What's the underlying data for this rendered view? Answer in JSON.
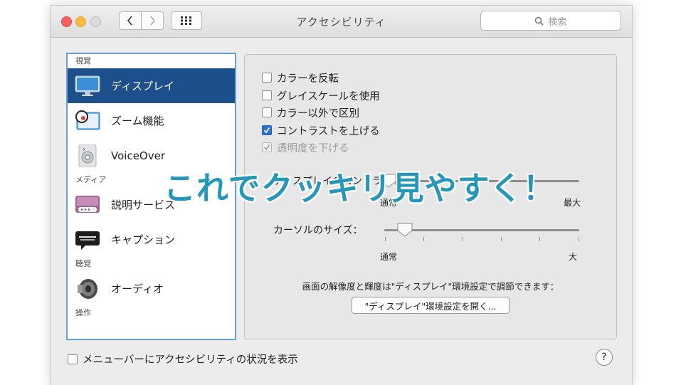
{
  "window": {
    "title": "アクセシビリティ"
  },
  "search": {
    "placeholder": "検索"
  },
  "sidebar": {
    "sections": [
      {
        "header": "視覚",
        "items": [
          {
            "label": "ディスプレイ",
            "icon": "display-icon",
            "selected": true
          },
          {
            "label": "ズーム機能",
            "icon": "zoom-icon",
            "selected": false
          },
          {
            "label": "VoiceOver",
            "icon": "voiceover-icon",
            "selected": false
          }
        ]
      },
      {
        "header": "メディア",
        "items": [
          {
            "label": "説明サービス",
            "icon": "descriptions-icon",
            "selected": false
          },
          {
            "label": "キャプション",
            "icon": "captions-icon",
            "selected": false
          }
        ]
      },
      {
        "header": "聴覚",
        "items": [
          {
            "label": "オーディオ",
            "icon": "speaker-icon",
            "selected": false
          }
        ]
      },
      {
        "header": "操作",
        "items": []
      }
    ]
  },
  "display": {
    "checkboxes": [
      {
        "label": "カラーを反転",
        "checked": false,
        "enabled": true
      },
      {
        "label": "グレイスケールを使用",
        "checked": false,
        "enabled": true
      },
      {
        "label": "カラー以外で区別",
        "checked": false,
        "enabled": true
      },
      {
        "label": "コントラストを上げる",
        "checked": true,
        "enabled": true
      },
      {
        "label": "透明度を下げる",
        "checked": true,
        "enabled": false
      }
    ],
    "contrast_slider": {
      "label": "ディスプレイのコントラスト：",
      "min_label": "通常",
      "max_label": "最大",
      "value": 0.0
    },
    "cursor_slider": {
      "label": "カーソルのサイズ：",
      "min_label": "通常",
      "max_label": "大",
      "value": 0.1
    },
    "note": "画面の解像度と輝度は\"ディスプレイ\"環境設定で調節できます：",
    "open_button": "\"ディスプレイ\"環境設定を開く..."
  },
  "footer": {
    "menubar_checkbox": "メニューバーにアクセシビリティの状況を表示",
    "menubar_checked": false,
    "help": "?"
  },
  "overlay_text": "これでクッキリ見やすく！",
  "colors": {
    "selection": "#1c4f8c",
    "overlay": "#2598b9",
    "checkbox_checked": "#2d6fce"
  }
}
